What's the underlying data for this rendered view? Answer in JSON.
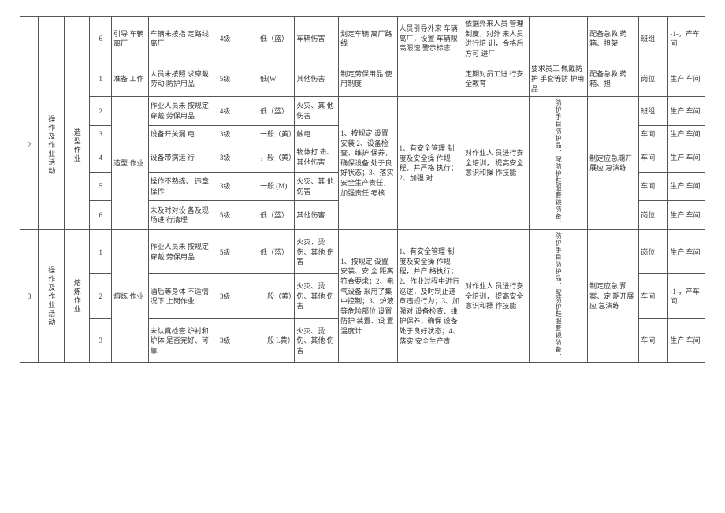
{
  "headers": {},
  "sec0": {
    "r6": {
      "idx": "6",
      "desc": "引导 车辆 离厂",
      "hazard": "车辆未按指 定路线离厂",
      "lvl": "4级",
      "risk": "低（蓝）",
      "type": "车辆伤害",
      "ctrl": "划定车辆 离厂路线",
      "mgmt": "人员引导外来 车辆离厂，设置 车辆限高限速 警示标志",
      "train": "依据外来人员 管理制度，对外 来人员进行培 训，合格后方可 进厂",
      "ppe": "",
      "emg": "配备急救 药箱、担架",
      "lvl2": "班组",
      "dept": "-1-，产车间"
    }
  },
  "sec2": {
    "activity": "操作及作业活动",
    "sub": "造型作业",
    "step": "造型 作业",
    "r1": {
      "idx": "1",
      "desc": "准备 工作",
      "hazard": "人员未按照 求穿戴劳动 防护用品",
      "lvl": "5级",
      "risk": "低(W",
      "type": "其他伤害",
      "ctrl": "制定劳保用品 使用制度",
      "mgmt": "",
      "train": "定期对员工进 行安全教育",
      "ppe": "要求员工 佩戴防护 手套等防 护用品",
      "emg": "配备急救 药箱、担",
      "lvl2": "岗位",
      "dept": "生产 车间"
    },
    "r2": {
      "idx": "2",
      "desc": "",
      "hazard": "作业人员未 按规定穿戴 劳保用品",
      "lvl": "4级",
      "risk": "低（蓝）",
      "type": "火灾、其 他伤害",
      "ctrl": "",
      "lvl2": "班组",
      "dept": "生产 车间"
    },
    "r3": {
      "idx": "3",
      "desc": "",
      "hazard": "设备开关漏 电",
      "lvl": "3级",
      "risk": "一般（黄）",
      "type": "触电",
      "ctrl": "",
      "lvl2": "车间",
      "dept": "生产 车间"
    },
    "r4": {
      "idx": "4",
      "desc": "",
      "hazard": "设备带病运 行",
      "lvl": "3级",
      "risk": "，般（黄）",
      "type": "物体打 击、其他伤害",
      "ctrl": "",
      "lvl2": "车间",
      "dept": "生产 车间"
    },
    "r5": {
      "idx": "5",
      "desc": "",
      "hazard": "操作不熟练、 违章操作",
      "lvl": "3级",
      "risk": "一般 (M)",
      "type": "火灾、其 他伤害",
      "ctrl": "",
      "lvl2": "车间",
      "dept": "生产 车间"
    },
    "r6": {
      "idx": "6",
      "desc": "",
      "hazard": "未及时对设 备及现场进 行清理",
      "lvl": "5级",
      "risk": "低（蓝）",
      "type": "其他伤害",
      "ctrl": "",
      "lvl2": "岗位",
      "dept": "生产 车间"
    },
    "engCtrl": "1、按规定 设置安装 2、设备检查、维护 保养，确保设备 处于良好状态；3、落实 安全生产责任， 加强责任 考核",
    "mgmt": "1、有安全管理 制度及安全操 作规程，并严格 执行；2、加强 对",
    "train": "对作业人 员进行安全培训， 提高安全意识和操 作技能",
    "ppe": "防护手目防护品、配防护鞋服套镜防备、",
    "emg": "制定应急期开展应 急演练"
  },
  "sec3": {
    "activity": "操作及作业活动",
    "sub": "熔炼作业",
    "step": "熔炼 作业",
    "r1": {
      "idx": "1",
      "desc": "",
      "hazard": "作业人员未 按规定穿戴 劳保用品",
      "lvl": "5级",
      "risk": "低（蓝）",
      "type": "火灾、烫 伤、其他 伤害",
      "ctrl": "",
      "lvl2": "岗位",
      "dept": "生产 车间"
    },
    "r2": {
      "idx": "2",
      "desc": "",
      "hazard": "酒后等身体 不适情况下 上岗作业",
      "lvl": "3级",
      "risk": "一般（黄）",
      "type": "火灾、烫 伤、其他 伤害",
      "ctrl": "",
      "lvl2": "车间",
      "dept": "-1-，产车间"
    },
    "r3": {
      "idx": "3",
      "desc": "",
      "hazard": "未认真检查 炉衬和炉体 是否完好、可靠",
      "lvl": "3级",
      "risk": "一般 L黄）",
      "type": "火灾、烫 伤、其他 伤害",
      "ctrl": "",
      "lvl2": "车间",
      "dept": "生产 车间"
    },
    "engCtrl": "1、按规定 设置安装、安 全 距离符合要求；2、电气设备 采用了集 中控制；3、炉液等危险部位 设置防护 装置、设 置温度计",
    "mgmt": "1、有安全管理 制度及安全操 作规程，并产 格执行；2、作业过程中进行 巡逻，及时制止违章违规行为；3、加强对 设备检查、维护保养，确保 设备处于良好状态；4、落实 安全生产责",
    "train": "对作业人 员进行安全培训， 提高安全意识和操 作技能",
    "ppe": "防护手目防护品、配防护鞋服套镜防备、",
    "emg": "制定应急 预案、定 期开展应 急演练"
  }
}
